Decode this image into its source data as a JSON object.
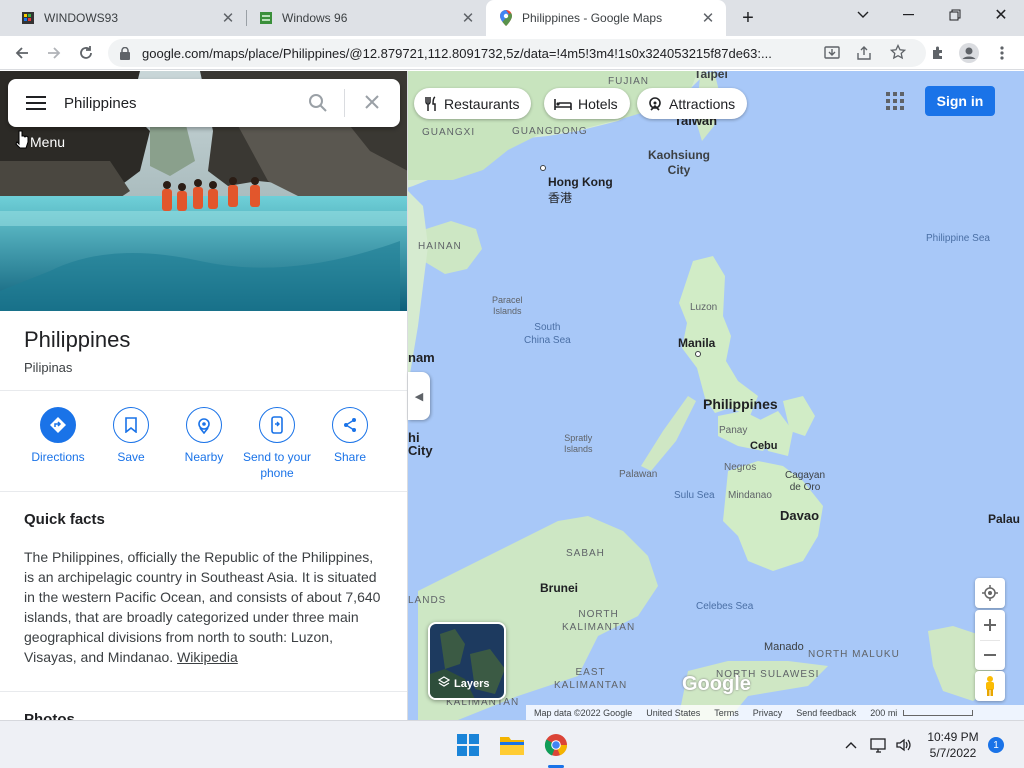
{
  "browser": {
    "tabs": [
      {
        "title": "WINDOWS93",
        "active": false,
        "favicon": "windows93-favicon"
      },
      {
        "title": "Windows 96",
        "active": false,
        "favicon": "windows96-favicon"
      },
      {
        "title": "Philippines - Google Maps",
        "active": true,
        "favicon": "maps-pin-favicon"
      }
    ],
    "new_tab": "+",
    "url": "google.com/maps/place/Philippines/@12.879721,112.8091732,5z/data=!4m5!3m4!1s0x324053215f87de63:..."
  },
  "search": {
    "value": "Philippines",
    "menu_tooltip": "Menu"
  },
  "place": {
    "title": "Philippines",
    "subtitle": "Pilipinas",
    "actions": [
      {
        "label": "Directions",
        "icon": "directions-icon"
      },
      {
        "label": "Save",
        "icon": "bookmark-icon"
      },
      {
        "label": "Nearby",
        "icon": "nearby-icon"
      },
      {
        "label": "Send to your phone",
        "icon": "phone-icon"
      },
      {
        "label": "Share",
        "icon": "share-icon"
      }
    ],
    "quick_facts_title": "Quick facts",
    "quick_facts_text": "The Philippines, officially the Republic of the Philippines, is an archipelagic country in Southeast Asia. It is situated in the western Pacific Ocean, and consists of about 7,640 islands, that are broadly categorized under three main geographical divisions from north to south: Luzon, Visayas, and Mindanao. ",
    "quick_facts_link": "Wikipedia",
    "photos_title": "Photos"
  },
  "map": {
    "chips": [
      {
        "label": "Restaurants",
        "icon": "fork-knife-icon"
      },
      {
        "label": "Hotels",
        "icon": "bed-icon"
      },
      {
        "label": "Attractions",
        "icon": "attraction-icon"
      }
    ],
    "sign_in": "Sign in",
    "layers_label": "Layers",
    "labels": {
      "taipei": "Taipei",
      "fujian": "FUJIAN",
      "guangxi": "GUANGXI",
      "guangdong": "GUANGDONG",
      "taiwan": "Taiwan",
      "kaohsiung": "Kaohsiung\nCity",
      "hongkong": "Hong Kong",
      "hongkong_cn": "香港",
      "hainan": "HAINAN",
      "philippine_sea": "Philippine Sea",
      "paracel": "Paracel\nIslands",
      "scs": "South\nChina Sea",
      "luzon": "Luzon",
      "manila": "Manila",
      "philippines": "Philippines",
      "nam": "nam",
      "panay": "Panay",
      "cebu": "Cebu",
      "negros": "Negros",
      "spratly": "Spratly\nIslands",
      "city": "City",
      "hi": "hi",
      "palawan": "Palawan",
      "cagayan": "Cagayan\nde Oro",
      "sulu": "Sulu Sea",
      "mindanao": "Mindanao",
      "davao": "Davao",
      "palau": "Palau",
      "sabah": "SABAH",
      "brunei": "Brunei",
      "north_kal": "NORTH\nKALIMANTAN",
      "celebes": "Celebes Sea",
      "lands": "LANDS",
      "manado": "Manado",
      "north_maluku": "NORTH MALUKU",
      "east_kal": "EAST\nKALIMANTAN",
      "north_sul": "NORTH SULAWESI",
      "kalimantan": "KALIMANTAN",
      "google": "Google"
    },
    "footer": [
      "Map data ©2022 Google",
      "United States",
      "Terms",
      "Privacy",
      "Send feedback",
      "200 mi"
    ]
  },
  "taskbar": {
    "time": "10:49 PM",
    "date": "5/7/2022",
    "notifications": "1"
  }
}
